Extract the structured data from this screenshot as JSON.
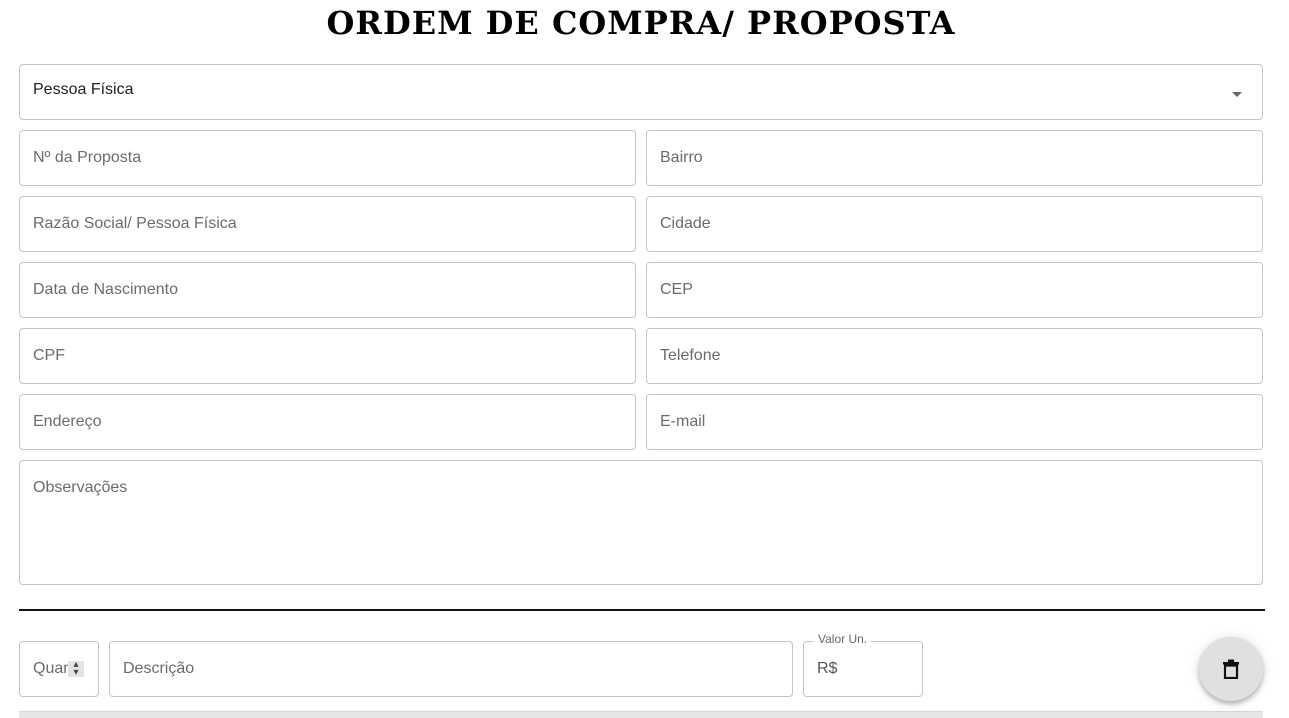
{
  "header": {
    "title": "ORDEM DE COMPRA/ PROPOSTA"
  },
  "form": {
    "person_type": {
      "selected": "Pessoa Física"
    },
    "fields": {
      "proposal_number": "Nº da Proposta",
      "neighborhood": "Bairro",
      "company_name": "Razão Social/ Pessoa Física",
      "city": "Cidade",
      "birth_date": "Data de Nascimento",
      "zip": "CEP",
      "cpf": "CPF",
      "phone": "Telefone",
      "address": "Endereço",
      "email": "E-mail",
      "notes": "Observações"
    }
  },
  "item": {
    "quantity_placeholder": "Quant.",
    "description_placeholder": "Descrição",
    "unit_value_label": "Valor Un.",
    "currency_prefix": "R$"
  },
  "icons": {
    "delete": "trash-icon",
    "dropdown": "caret-down-icon"
  },
  "colors": {
    "border": "#c4c4c4",
    "fab_bg": "#e0e0e0"
  }
}
